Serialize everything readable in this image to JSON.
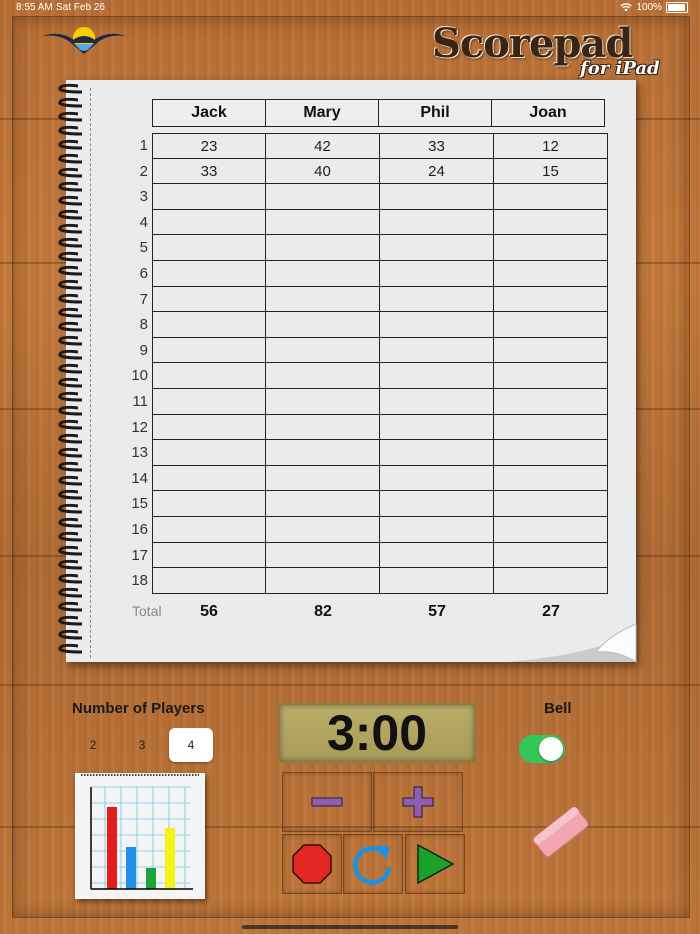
{
  "status_bar": {
    "time": "8:55 AM",
    "date": "Sat Feb 26",
    "battery": "100%"
  },
  "brand": {
    "title": "Scorepad",
    "subtitle": "for iPad"
  },
  "scoresheet": {
    "players": [
      "Jack",
      "Mary",
      "Phil",
      "Joan"
    ],
    "rounds": [
      "1",
      "2",
      "3",
      "4",
      "5",
      "6",
      "7",
      "8",
      "9",
      "10",
      "11",
      "12",
      "13",
      "14",
      "15",
      "16",
      "17",
      "18"
    ],
    "scores": [
      [
        "23",
        "42",
        "33",
        "12"
      ],
      [
        "33",
        "40",
        "24",
        "15"
      ],
      [
        "",
        "",
        "",
        ""
      ],
      [
        "",
        "",
        "",
        ""
      ],
      [
        "",
        "",
        "",
        ""
      ],
      [
        "",
        "",
        "",
        ""
      ],
      [
        "",
        "",
        "",
        ""
      ],
      [
        "",
        "",
        "",
        ""
      ],
      [
        "",
        "",
        "",
        ""
      ],
      [
        "",
        "",
        "",
        ""
      ],
      [
        "",
        "",
        "",
        ""
      ],
      [
        "",
        "",
        "",
        ""
      ],
      [
        "",
        "",
        "",
        ""
      ],
      [
        "",
        "",
        "",
        ""
      ],
      [
        "",
        "",
        "",
        ""
      ],
      [
        "",
        "",
        "",
        ""
      ],
      [
        "",
        "",
        "",
        ""
      ],
      [
        "",
        "",
        "",
        ""
      ]
    ],
    "total_label": "Total",
    "totals": [
      "56",
      "82",
      "57",
      "27"
    ]
  },
  "players_selector": {
    "label": "Number of Players",
    "options": [
      "2",
      "3",
      "4"
    ],
    "selected": "4"
  },
  "timer": {
    "display": "3:00"
  },
  "bell": {
    "label": "Bell",
    "enabled": true
  },
  "icons": {
    "logo": "bird-logo-icon",
    "chart": "bar-chart-icon",
    "minus": "minus-icon",
    "plus": "plus-icon",
    "stop": "stop-icon",
    "reset": "reset-icon",
    "play": "play-icon",
    "eraser": "eraser-icon"
  },
  "colors": {
    "toggle_on": "#34c759",
    "minus": "#8e5fb0",
    "plus": "#8e5fb0",
    "stop": "#e32626",
    "reset": "#1e90e0",
    "play": "#1e9e2a"
  }
}
